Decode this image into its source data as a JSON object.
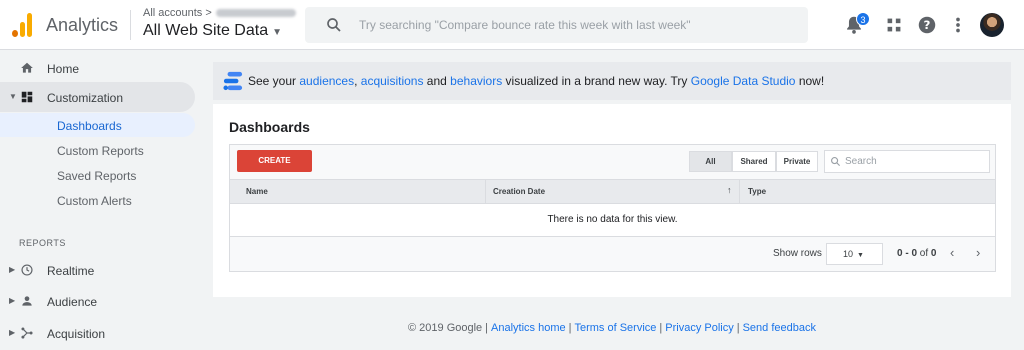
{
  "header": {
    "app_name": "Analytics",
    "account_crumb": "All accounts",
    "property_name": "All Web Site Data",
    "search_placeholder": "Try searching \"Compare bounce rate this week with last week\"",
    "notification_count": "3"
  },
  "sidebar": {
    "home": "Home",
    "customization": "Customization",
    "sub_items": [
      "Dashboards",
      "Custom Reports",
      "Saved Reports",
      "Custom Alerts"
    ],
    "reports_heading": "REPORTS",
    "realtime": "Realtime",
    "audience": "Audience",
    "acquisition": "Acquisition"
  },
  "banner": {
    "t1": "See your ",
    "link_audiences": "audiences",
    "t2": ", ",
    "link_acquisitions": "acquisitions",
    "t3": " and ",
    "link_behaviors": "behaviors",
    "t4": " visualized in a brand new way. Try ",
    "link_gds": "Google Data Studio",
    "t5": " now!"
  },
  "dashboards": {
    "title": "Dashboards",
    "create_label": "CREATE",
    "filters": [
      "All",
      "Shared",
      "Private"
    ],
    "search_placeholder": "Search",
    "columns": [
      "Name",
      "Creation Date",
      "Type"
    ],
    "sort_indicator": "↑",
    "empty_message": "There is no data for this view.",
    "show_rows_label": "Show rows",
    "rows_value": "10",
    "range_start": "0",
    "range_dash": " - ",
    "range_end": "0",
    "range_of": " of ",
    "range_total": "0"
  },
  "footer": {
    "copyright": "© 2019 Google",
    "links": [
      "Analytics home",
      "Terms of Service",
      "Privacy Policy",
      "Send feedback"
    ]
  },
  "colors": {
    "accent": "#1a73e8",
    "create": "#db4437",
    "logo_orange": "#e37400",
    "logo_yellow": "#f9ab00"
  }
}
